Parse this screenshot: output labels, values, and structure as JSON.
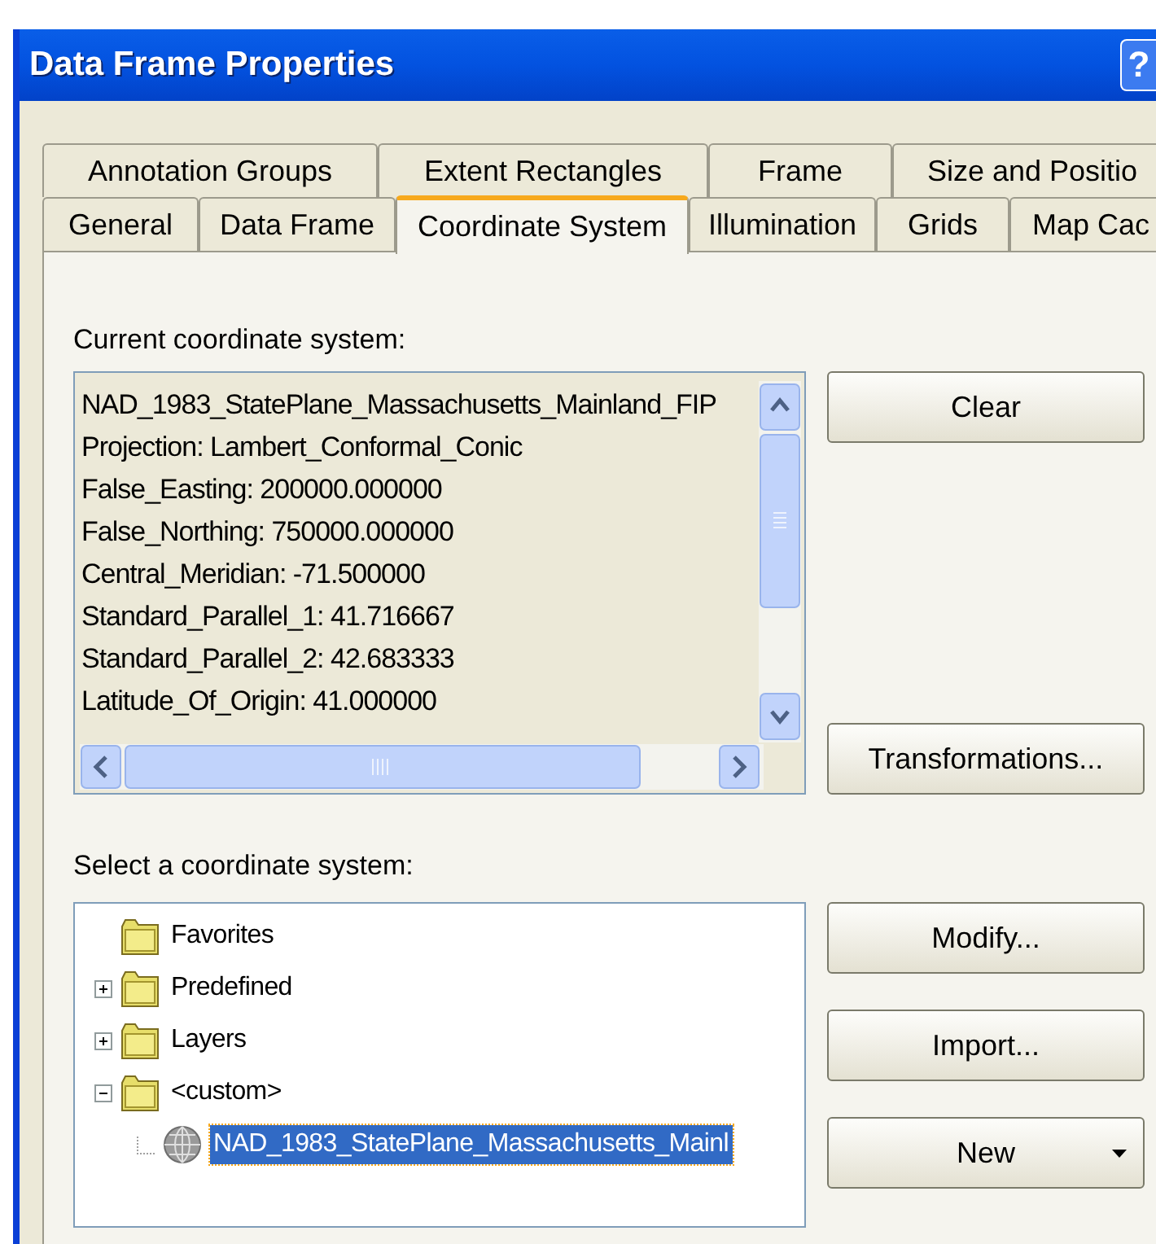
{
  "window": {
    "title": "Data Frame Properties",
    "help_button": "?"
  },
  "tab_rows": [
    [
      {
        "label": "Annotation Groups",
        "selected": false
      },
      {
        "label": "Extent Rectangles",
        "selected": false
      },
      {
        "label": "Frame",
        "selected": false
      },
      {
        "label": "Size and Positio",
        "selected": false
      }
    ],
    [
      {
        "label": "General",
        "selected": false
      },
      {
        "label": "Data Frame",
        "selected": false
      },
      {
        "label": "Coordinate System",
        "selected": true
      },
      {
        "label": "Illumination",
        "selected": false
      },
      {
        "label": "Grids",
        "selected": false
      },
      {
        "label": "Map Cac",
        "selected": false
      }
    ]
  ],
  "current": {
    "label": "Current coordinate system:",
    "lines": [
      "NAD_1983_StatePlane_Massachusetts_Mainland_FIP",
      "Projection: Lambert_Conformal_Conic",
      "False_Easting: 200000.000000",
      "False_Northing: 750000.000000",
      "Central_Meridian: -71.500000",
      "Standard_Parallel_1: 41.716667",
      "Standard_Parallel_2: 42.683333",
      "Latitude_Of_Origin: 41.000000"
    ],
    "buttons": [
      "Clear",
      "Transformations..."
    ]
  },
  "select": {
    "label": "Select a coordinate system:",
    "tree": [
      {
        "label": "Favorites",
        "kind": "folder",
        "selected": false
      },
      {
        "label": "Predefined",
        "kind": "expandable-folder",
        "expanded": false,
        "selected": false
      },
      {
        "label": "Layers",
        "kind": "expandable-folder",
        "expanded": false,
        "selected": false
      },
      {
        "label": "<custom>",
        "kind": "expandable-folder",
        "expanded": true,
        "selected": false,
        "children": [
          {
            "label": "NAD_1983_StatePlane_Massachusetts_Mainl",
            "kind": "coordinate-system",
            "selected": true
          }
        ]
      }
    ],
    "buttons": [
      {
        "label": "Modify...",
        "kind": "plain"
      },
      {
        "label": "Import...",
        "kind": "plain"
      },
      {
        "label": "New",
        "kind": "dropdown"
      }
    ]
  }
}
